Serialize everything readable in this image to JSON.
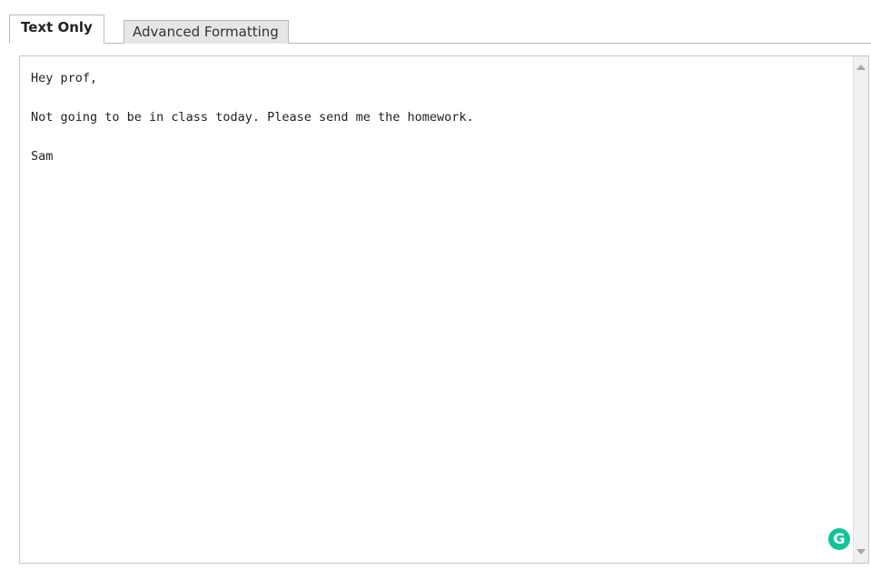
{
  "tabs": [
    {
      "label": "Text Only",
      "active": true
    },
    {
      "label": "Advanced Formatting",
      "active": false
    }
  ],
  "editor": {
    "lines": [
      "Hey prof,",
      "Not going to be in class today. Please send me the homework.",
      "Sam"
    ]
  },
  "badge": {
    "icon": "grammarly-icon",
    "glyph": "G",
    "color": "#15c39a"
  }
}
